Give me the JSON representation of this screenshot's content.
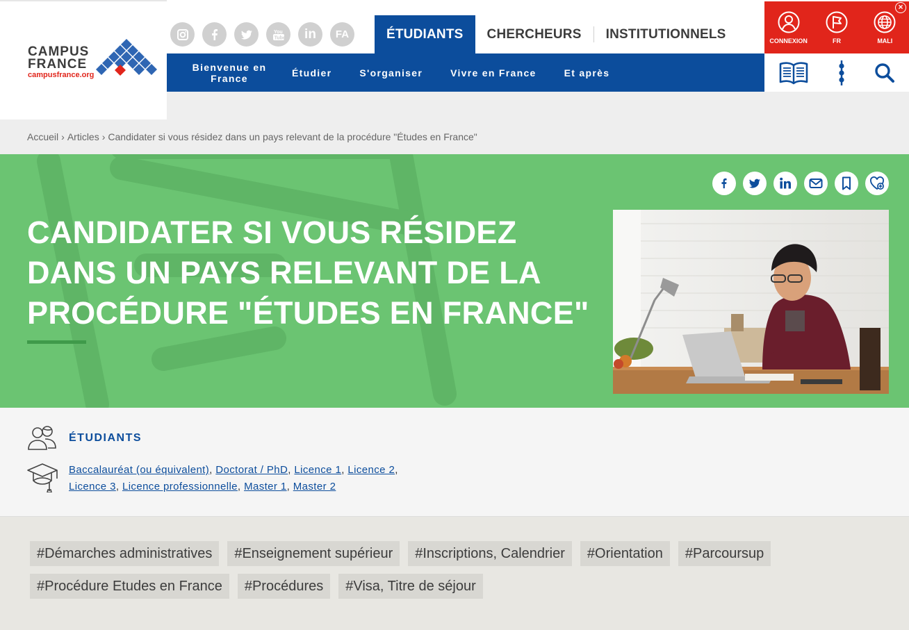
{
  "logo": {
    "line1": "CAMPUS",
    "line2": "FRANCE",
    "url": "campusfrance.org"
  },
  "socials": [
    {
      "name": "instagram-icon"
    },
    {
      "name": "facebook-icon"
    },
    {
      "name": "twitter-icon"
    },
    {
      "name": "youtube-icon"
    },
    {
      "name": "linkedin-icon",
      "label": "in"
    },
    {
      "name": "fa-icon",
      "label": "FA"
    }
  ],
  "main_tabs": [
    {
      "label": "ÉTUDIANTS",
      "active": true
    },
    {
      "label": "CHERCHEURS",
      "active": false
    },
    {
      "label": "INSTITUTIONNELS",
      "active": false
    }
  ],
  "nav": {
    "item1": "Bienvenue en France",
    "item2": "Étudier",
    "item3": "S'organiser",
    "item4": "Vivre en France",
    "item5": "Et après"
  },
  "utility": {
    "connexion": "CONNEXION",
    "lang": "FR",
    "country": "MALI",
    "close": "×"
  },
  "breadcrumb": {
    "home": "Accueil",
    "articles": "Articles",
    "current": "Candidater si vous résidez dans un pays relevant de la procédure \"Études en France\""
  },
  "hero": {
    "title": "CANDIDATER SI VOUS RÉSIDEZ DANS UN PAYS RELEVANT DE LA PROCÉDURE \"ÉTUDES EN FRANCE\""
  },
  "audience": {
    "title": "ÉTUDIANTS",
    "levels": [
      "Baccalauréat (ou équivalent)",
      "Doctorat / PhD",
      "Licence 1",
      "Licence 2",
      "Licence 3",
      "Licence professionnelle",
      "Master 1",
      "Master 2"
    ]
  },
  "tags": [
    "#Démarches administratives",
    "#Enseignement supérieur",
    "#Inscriptions, Calendrier",
    "#Orientation",
    "#Parcoursup",
    "#Procédure Etudes en France",
    "#Procédures",
    "#Visa, Titre de séjour"
  ],
  "colors": {
    "brand_blue": "#0c4d9c",
    "brand_red": "#e1251b",
    "hero_green": "#6bc472"
  }
}
